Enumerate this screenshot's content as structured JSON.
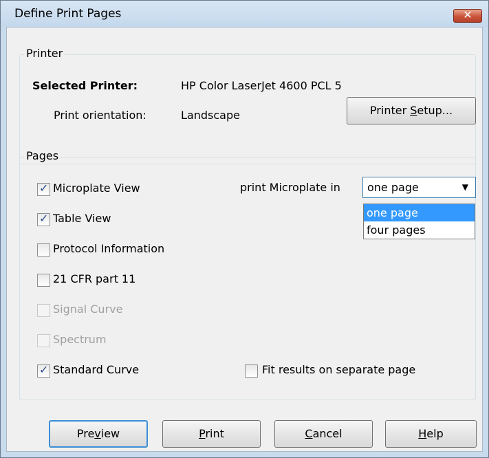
{
  "window": {
    "title": "Define Print Pages",
    "close_glyph": "✕"
  },
  "printer_group": {
    "label": "Printer",
    "selected_printer_label": "Selected Printer:",
    "selected_printer_value": "HP Color LaserJet 4600 PCL 5",
    "orientation_label": "Print orientation:",
    "orientation_value": "Landscape",
    "setup_button": {
      "pre": "Printer ",
      "accel": "S",
      "post": "etup..."
    }
  },
  "pages_group": {
    "label": "Pages",
    "checkboxes": [
      {
        "label": "Microplate View",
        "checked": true,
        "disabled": false
      },
      {
        "label": "Table View",
        "checked": true,
        "disabled": false
      },
      {
        "label": "Protocol Information",
        "checked": false,
        "disabled": false
      },
      {
        "label": "21 CFR part 11",
        "checked": false,
        "disabled": false
      },
      {
        "label": "Signal Curve",
        "checked": false,
        "disabled": true
      },
      {
        "label": "Spectrum",
        "checked": false,
        "disabled": true
      },
      {
        "label": "Standard Curve",
        "checked": true,
        "disabled": false
      }
    ],
    "microplate_print_label": "print Microplate in",
    "microplate_select": {
      "value": "one page",
      "options": [
        "one page",
        "four pages"
      ],
      "highlighted": "one page"
    },
    "fit_results": {
      "label": "Fit results on separate  page",
      "checked": false
    }
  },
  "buttons": {
    "preview": {
      "pre": "Pre",
      "accel": "v",
      "post": "iew"
    },
    "print": {
      "pre": "",
      "accel": "P",
      "post": "rint"
    },
    "cancel": {
      "pre": "",
      "accel": "C",
      "post": "ancel"
    },
    "help": {
      "pre": "",
      "accel": "H",
      "post": "elp"
    }
  }
}
